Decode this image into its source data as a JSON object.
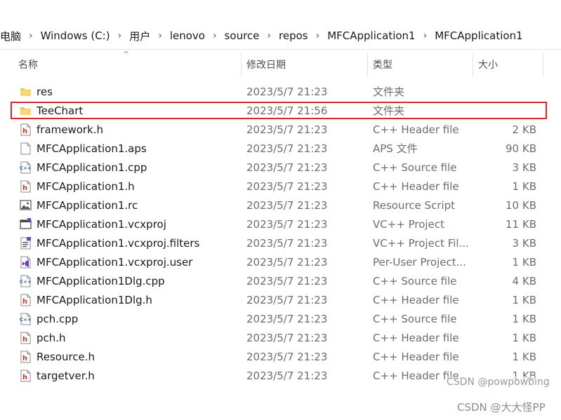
{
  "breadcrumb": [
    "电脑",
    "Windows (C:)",
    "用户",
    "lenovo",
    "source",
    "repos",
    "MFCApplication1",
    "MFCApplication1"
  ],
  "columns": {
    "name": "名称",
    "date": "修改日期",
    "type": "类型",
    "size": "大小"
  },
  "files": [
    {
      "icon": "folder-icon",
      "name": "res",
      "date": "2023/5/7 21:23",
      "type": "文件夹",
      "size": ""
    },
    {
      "icon": "folder-icon",
      "name": "TeeChart",
      "date": "2023/5/7 21:56",
      "type": "文件夹",
      "size": "",
      "highlighted": true
    },
    {
      "icon": "header-file-icon",
      "name": "framework.h",
      "date": "2023/5/7 21:23",
      "type": "C++ Header file",
      "size": "2 KB"
    },
    {
      "icon": "generic-file-icon",
      "name": "MFCApplication1.aps",
      "date": "2023/5/7 21:23",
      "type": "APS 文件",
      "size": "90 KB"
    },
    {
      "icon": "cpp-file-icon",
      "name": "MFCApplication1.cpp",
      "date": "2023/5/7 21:23",
      "type": "C++ Source file",
      "size": "3 KB"
    },
    {
      "icon": "header-file-icon",
      "name": "MFCApplication1.h",
      "date": "2023/5/7 21:23",
      "type": "C++ Header file",
      "size": "1 KB"
    },
    {
      "icon": "resource-script-icon",
      "name": "MFCApplication1.rc",
      "date": "2023/5/7 21:23",
      "type": "Resource Script",
      "size": "10 KB"
    },
    {
      "icon": "vcxproj-icon",
      "name": "MFCApplication1.vcxproj",
      "date": "2023/5/7 21:23",
      "type": "VC++ Project",
      "size": "11 KB"
    },
    {
      "icon": "filters-file-icon",
      "name": "MFCApplication1.vcxproj.filters",
      "date": "2023/5/7 21:23",
      "type": "VC++ Project Fil...",
      "size": "3 KB"
    },
    {
      "icon": "vs-user-file-icon",
      "name": "MFCApplication1.vcxproj.user",
      "date": "2023/5/7 21:23",
      "type": "Per-User Project...",
      "size": "1 KB"
    },
    {
      "icon": "cpp-file-icon",
      "name": "MFCApplication1Dlg.cpp",
      "date": "2023/5/7 21:23",
      "type": "C++ Source file",
      "size": "4 KB"
    },
    {
      "icon": "header-file-icon",
      "name": "MFCApplication1Dlg.h",
      "date": "2023/5/7 21:23",
      "type": "C++ Header file",
      "size": "1 KB"
    },
    {
      "icon": "cpp-file-icon",
      "name": "pch.cpp",
      "date": "2023/5/7 21:23",
      "type": "C++ Source file",
      "size": "1 KB"
    },
    {
      "icon": "header-file-icon",
      "name": "pch.h",
      "date": "2023/5/7 21:23",
      "type": "C++ Header file",
      "size": "1 KB"
    },
    {
      "icon": "header-file-icon",
      "name": "Resource.h",
      "date": "2023/5/7 21:23",
      "type": "C++ Header file",
      "size": "1 KB"
    },
    {
      "icon": "header-file-icon",
      "name": "targetver.h",
      "date": "2023/5/7 21:23",
      "type": "C++ Header file",
      "size": "1 KB"
    }
  ],
  "watermarks": [
    "CSDN @powpowbing",
    "CSDN @大大怪PP"
  ],
  "colors": {
    "highlight_border": "#d9262b",
    "folder": "#f2c14e",
    "header_icon": "#c0392b",
    "cpp_icon": "#2b6cb0",
    "vs_purple": "#6e3fbf"
  }
}
